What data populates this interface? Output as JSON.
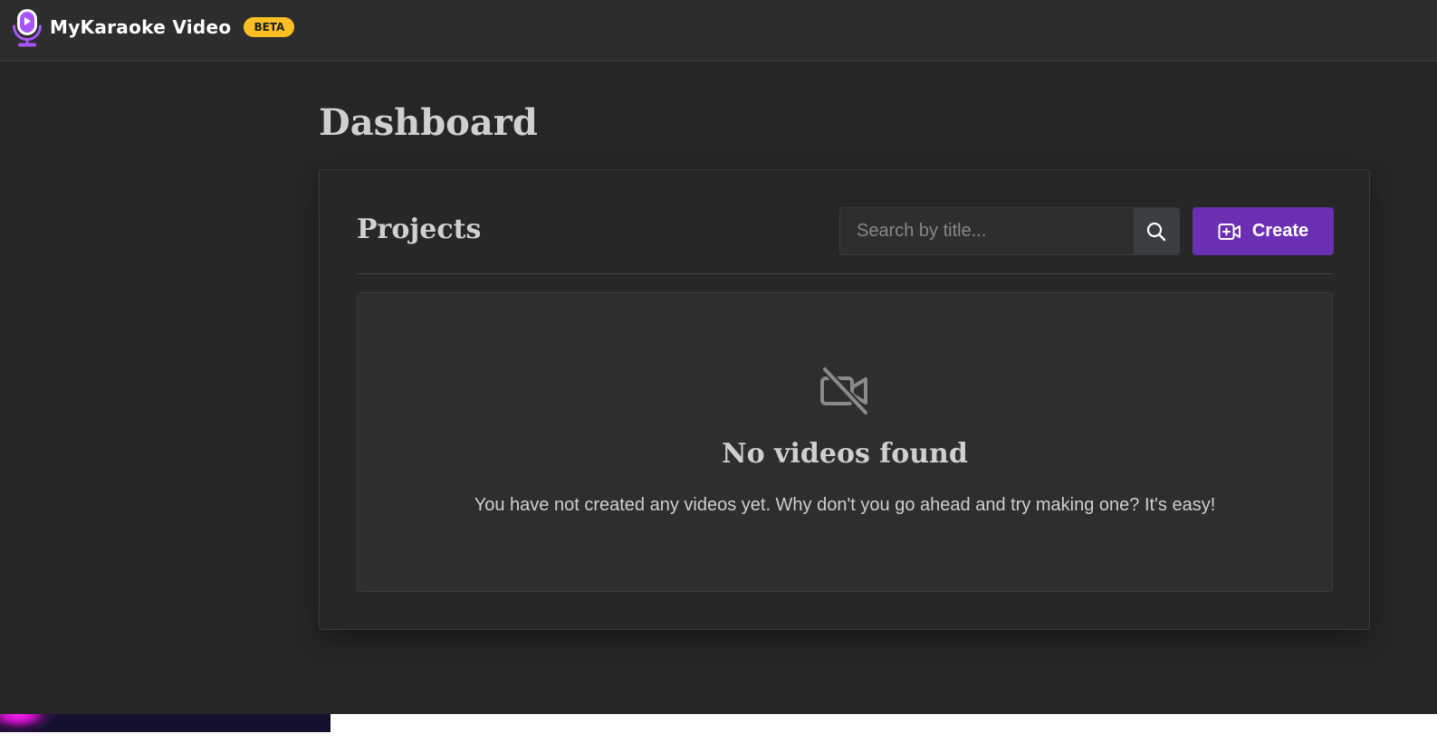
{
  "header": {
    "app_name": "MyKaraoke Video",
    "badge": "BETA",
    "logo_icon": "microphone-icon"
  },
  "page": {
    "title": "Dashboard"
  },
  "projects": {
    "title": "Projects",
    "search": {
      "placeholder": "Search by title...",
      "value": "",
      "icon": "search-icon"
    },
    "create_button": {
      "label": "Create",
      "icon": "video-plus-icon"
    },
    "empty_state": {
      "icon": "video-off-icon",
      "title": "No videos found",
      "message": "You have not created any videos yet. Why don't you go ahead and try making one? It's easy!"
    }
  },
  "colors": {
    "background": "#262626",
    "header": "#2d2d2d",
    "accent": "#6b2fb3",
    "badge": "#fbbf24",
    "logo": "#a855f7",
    "text": "#d0d0d0"
  }
}
